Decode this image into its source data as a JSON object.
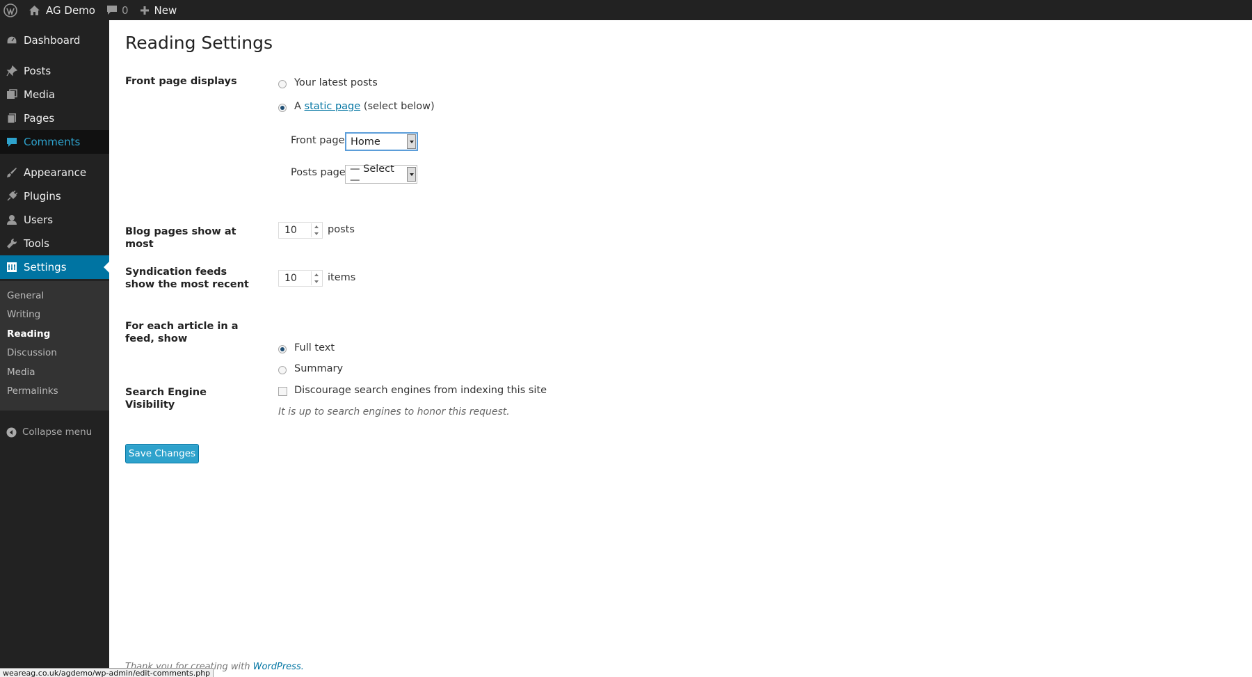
{
  "admin_bar": {
    "site_name": "AG Demo",
    "comments_count": "0",
    "new_label": "New"
  },
  "sidebar": {
    "items": [
      {
        "label": "Dashboard",
        "icon": "dashboard-icon"
      },
      {
        "label": "Posts",
        "icon": "pin-icon"
      },
      {
        "label": "Media",
        "icon": "media-icon"
      },
      {
        "label": "Pages",
        "icon": "pages-icon"
      },
      {
        "label": "Comments",
        "icon": "comment-icon"
      },
      {
        "label": "Appearance",
        "icon": "brush-icon"
      },
      {
        "label": "Plugins",
        "icon": "plug-icon"
      },
      {
        "label": "Users",
        "icon": "user-icon"
      },
      {
        "label": "Tools",
        "icon": "wrench-icon"
      },
      {
        "label": "Settings",
        "icon": "settings-icon"
      }
    ],
    "submenu": [
      "General",
      "Writing",
      "Reading",
      "Discussion",
      "Media",
      "Permalinks"
    ],
    "collapse_label": "Collapse menu"
  },
  "page": {
    "title": "Reading Settings",
    "front_page_displays": {
      "label": "Front page displays",
      "option_latest": "Your latest posts",
      "option_static_prefix": "A",
      "option_static_link": "static page",
      "option_static_suffix": "(select below)",
      "front_page_label": "Front page:",
      "front_page_value": "Home",
      "posts_page_label": "Posts page:",
      "posts_page_value": "— Select —"
    },
    "blog_pages": {
      "label": "Blog pages show at most",
      "value": "10",
      "unit": "posts"
    },
    "syndication": {
      "label": "Syndication feeds show the most recent",
      "value": "10",
      "unit": "items"
    },
    "feed_article": {
      "label": "For each article in a feed, show",
      "option_full": "Full text",
      "option_summary": "Summary"
    },
    "search_visibility": {
      "label": "Search Engine Visibility",
      "checkbox_label": "Discourage search engines from indexing this site",
      "description": "It is up to search engines to honor this request."
    },
    "save_button": "Save Changes"
  },
  "footer": {
    "text": "Thank you for creating with",
    "link": "WordPress."
  },
  "status_bar": {
    "url": "weareag.co.uk/agdemo/wp-admin/edit-comments.php"
  },
  "colors": {
    "admin_bar_bg": "#222222",
    "sidebar_current": "#0074a2",
    "sidebar_hover_text": "#2ea2cc",
    "primary_button": "#2ea2cc",
    "link": "#0074a2"
  }
}
